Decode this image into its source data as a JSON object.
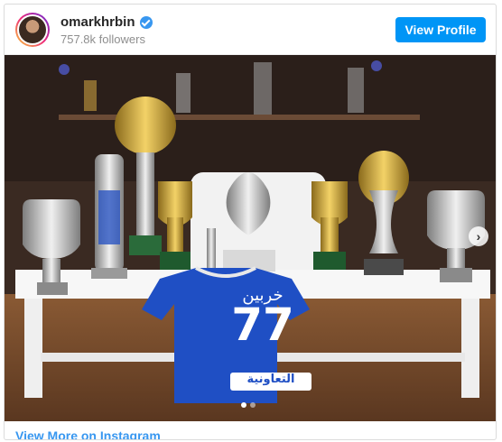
{
  "header": {
    "username": "omarkhrbin",
    "followers": "757.8k followers",
    "view_profile_label": "View Profile"
  },
  "photo": {
    "jersey_name": "خربين",
    "jersey_number": "77",
    "sponsor": "التعاونية"
  },
  "footer": {
    "link_label": "View More on Instagram"
  },
  "icons": {
    "verified": "verified-badge-icon",
    "next": "chevron-right-icon"
  },
  "colors": {
    "accent": "#0095f6",
    "link": "#3897f0",
    "jersey": "#1f4fc4"
  }
}
